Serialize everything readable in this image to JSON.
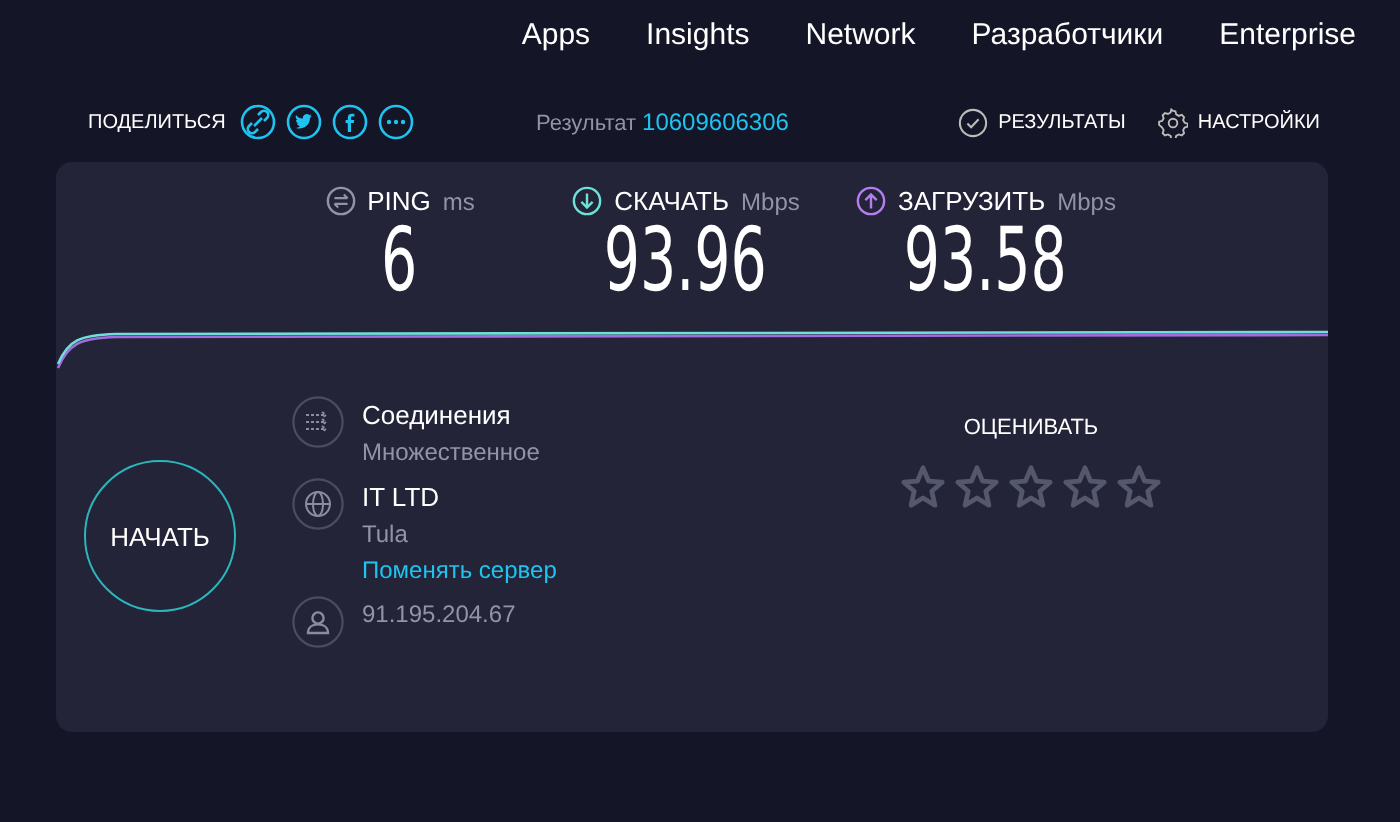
{
  "nav": [
    "Apps",
    "Insights",
    "Network",
    "Разработчики",
    "Enterprise"
  ],
  "share": {
    "label": "ПОДЕЛИТЬСЯ",
    "icons": [
      {
        "kind": "link"
      },
      {
        "kind": "twitter"
      },
      {
        "kind": "facebook"
      },
      {
        "kind": "more"
      }
    ]
  },
  "result": {
    "label": "Результат",
    "id": "10609606306"
  },
  "actions": [
    {
      "kind": "results",
      "label": "РЕЗУЛЬТАТЫ"
    },
    {
      "kind": "settings",
      "label": "НАСТРОЙКИ"
    }
  ],
  "metrics": [
    {
      "kind": "ping",
      "label": "PING",
      "unit": "ms",
      "value": "6"
    },
    {
      "kind": "download",
      "label": "СКАЧАТЬ",
      "unit": "Mbps",
      "value": "93.96"
    },
    {
      "kind": "upload",
      "label": "ЗАГРУЗИТЬ",
      "unit": "Mbps",
      "value": "93.58"
    }
  ],
  "start_button": "НАЧАТЬ",
  "info": [
    {
      "kind": "connections",
      "title": "Соединения",
      "lines": [
        "Множественное"
      ]
    },
    {
      "kind": "server",
      "title": "IT LTD",
      "lines": [
        "Tula"
      ],
      "link": "Поменять сервер"
    },
    {
      "kind": "user",
      "lines": [
        "91.195.204.67"
      ]
    }
  ],
  "rating": {
    "label": "ОЦЕНИВАТЬ",
    "stars": 0
  }
}
